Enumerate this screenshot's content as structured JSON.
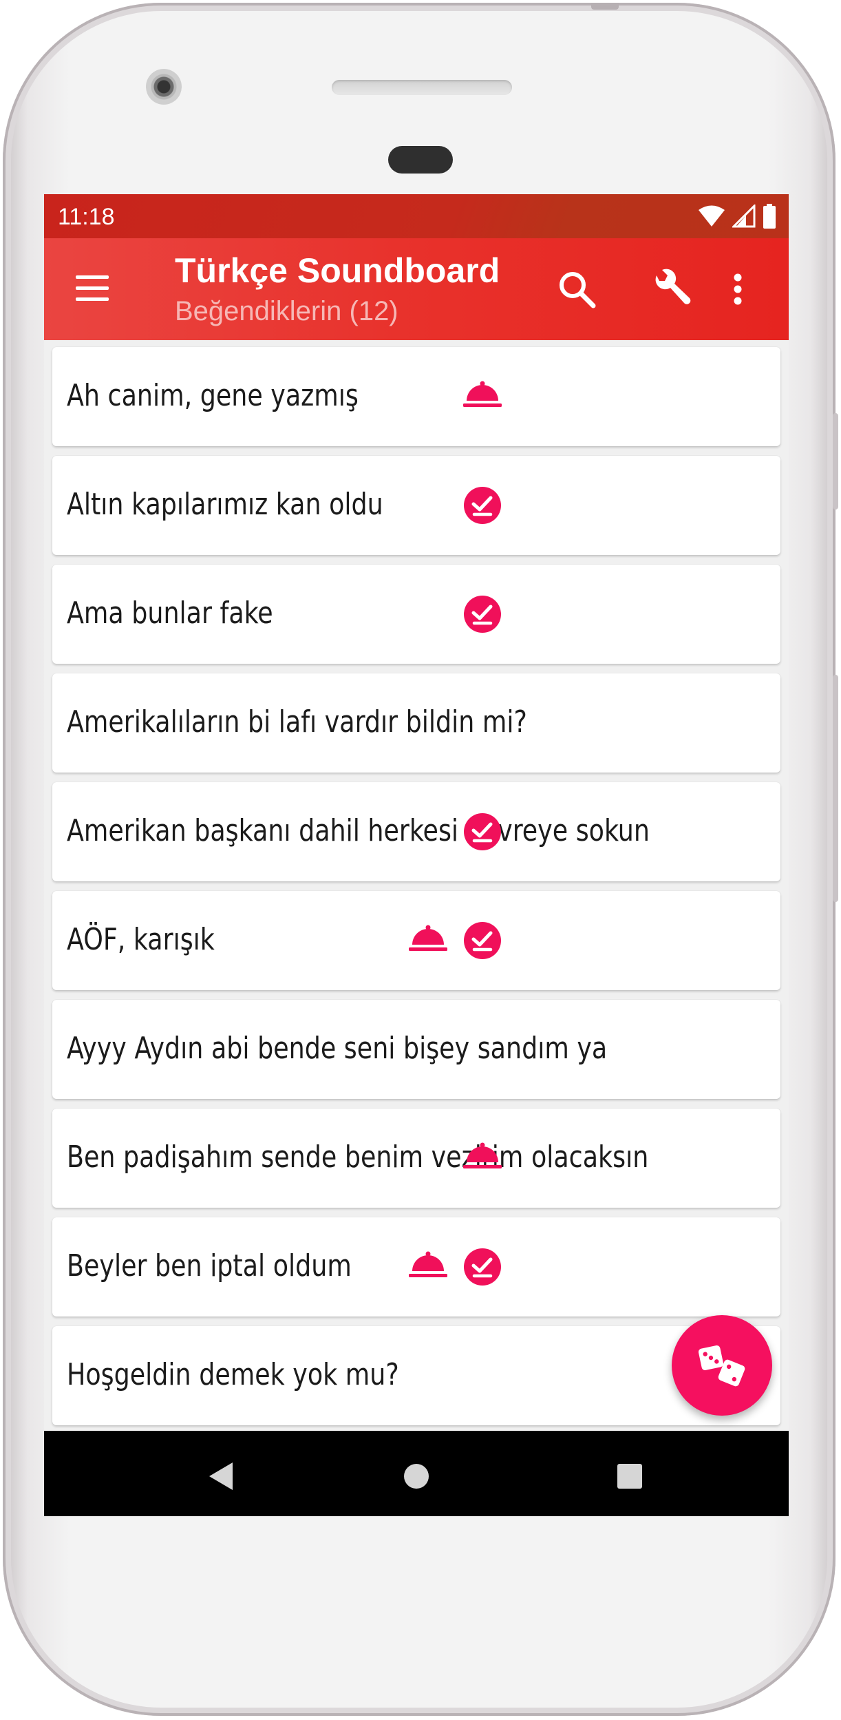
{
  "status_bar": {
    "time": "11:18"
  },
  "app_bar": {
    "title": "Türkçe Soundboard",
    "subtitle": "Beğendiklerin (12)"
  },
  "colors": {
    "app_bar": "#e8312b",
    "status_bar": "#c9241c",
    "accent": "#f5105f",
    "background": "#f0f0f0"
  },
  "sounds": [
    {
      "label": "Ah canim, gene yazmış",
      "bell": true,
      "checked": false
    },
    {
      "label": "Altın kapılarımız kan oldu",
      "bell": false,
      "checked": true
    },
    {
      "label": "Ama bunlar fake",
      "bell": false,
      "checked": true
    },
    {
      "label": "Amerikalıların bi lafı vardır bildin mi?",
      "bell": false,
      "checked": false
    },
    {
      "label": "Amerikan başkanı dahil herkesi devreye sokun",
      "bell": false,
      "checked": true
    },
    {
      "label": "AÖF, karışık",
      "bell": true,
      "checked": true
    },
    {
      "label": "Ayyy Aydın abi bende seni bişey sandım ya",
      "bell": false,
      "checked": false
    },
    {
      "label": "Ben padişahım sende benim vezirim olacaksın",
      "bell": true,
      "checked": false
    },
    {
      "label": "Beyler ben iptal oldum",
      "bell": true,
      "checked": true
    },
    {
      "label": "Hoşgeldin demek yok mu?",
      "bell": false,
      "checked": false
    }
  ],
  "icons": {
    "menu": "hamburger-menu-icon",
    "search": "search-icon",
    "settings": "wrench-icon",
    "overflow": "more-vert-icon",
    "bell": "room-service-bell-icon",
    "check": "check-circle-icon",
    "fab": "dice-icon",
    "nav_back": "back-triangle-icon",
    "nav_home": "home-circle-icon",
    "nav_recents": "recents-square-icon"
  }
}
